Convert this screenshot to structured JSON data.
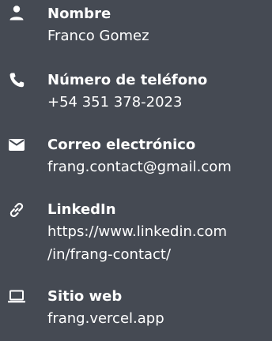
{
  "contact": {
    "items": [
      {
        "icon": "person-icon",
        "label": "Nombre",
        "value": "Franco Gomez"
      },
      {
        "icon": "phone-icon",
        "label": "Número de teléfono",
        "value": "+54 351 378-2023"
      },
      {
        "icon": "mail-icon",
        "label": "Correo electrónico",
        "value": "frang.contact@gmail.com"
      },
      {
        "icon": "link-icon",
        "label": "LinkedIn",
        "value_line1": "https://www.linkedin.com",
        "value_line2": "/in/frang-contact/"
      },
      {
        "icon": "laptop-icon",
        "label": "Sitio web",
        "value": "frang.vercel.app"
      }
    ]
  }
}
